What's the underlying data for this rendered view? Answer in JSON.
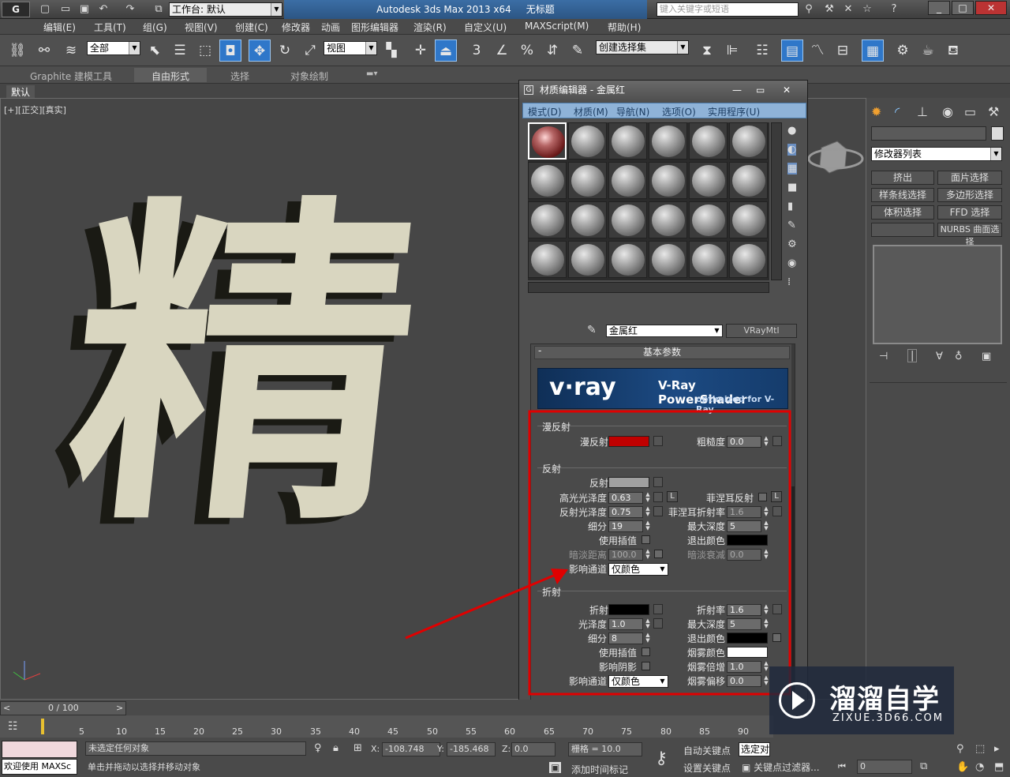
{
  "window": {
    "app_title": "Autodesk 3ds Max  2013 x64",
    "doc_title": "无标题",
    "workspace": "工作台: 默认",
    "search_placeholder": "键入关键字或短语"
  },
  "menu": [
    "编辑(E)",
    "工具(T)",
    "组(G)",
    "视图(V)",
    "创建(C)",
    "修改器",
    "动画",
    "图形编辑器",
    "渲染(R)",
    "自定义(U)",
    "MAXScript(M)",
    "帮助(H)"
  ],
  "toolbar": {
    "selection_filter": "全部",
    "ref_coord": "视图",
    "named_selection": "创建选择集",
    "snap_3": "3",
    "snap_percent": "%"
  },
  "ribbon": {
    "tabs": [
      "Graphite 建模工具",
      "自由形式",
      "选择",
      "对象绘制"
    ],
    "active": "自由形式",
    "sub_default": "默认"
  },
  "viewport": {
    "label": "[+][正交][真实]",
    "model_text": "精"
  },
  "command_panel": {
    "modifier_list": "修改器列表",
    "buttons": [
      "挤出",
      "面片选择",
      "样条线选择",
      "多边形选择",
      "体积选择",
      "FFD 选择",
      "",
      "NURBS 曲面选择"
    ]
  },
  "material_editor": {
    "title": "材质编辑器 - 金属红",
    "menu": [
      "模式(D)",
      "材质(M)",
      "导航(N)",
      "选项(O)",
      "实用程序(U)"
    ],
    "material_name": "金属红",
    "material_type": "VRayMtl",
    "rollout_title": "基本参数",
    "banner_logo": "v·ray",
    "banner_title": "V-Ray PowerShader",
    "banner_sub": "optimized for V-Ray",
    "diffuse": {
      "group": "漫反射",
      "label": "漫反射",
      "color": "#c00000",
      "roughness_label": "粗糙度",
      "roughness": "0.0"
    },
    "reflection": {
      "group": "反射",
      "label": "反射",
      "color": "#a0a0a0",
      "hilight_label": "高光光泽度",
      "hilight": "0.63",
      "l_btn": "L",
      "glossy_label": "反射光泽度",
      "glossy": "0.75",
      "subdiv_label": "细分",
      "subdiv": "19",
      "interp_label": "使用插值",
      "dim_dist_label": "暗淡距离",
      "dim_dist": "100.0",
      "affect_label": "影响通道",
      "affect_value": "仅颜色",
      "fresnel_label": "菲涅耳反射",
      "fresnel_ior_label": "菲涅耳折射率",
      "fresnel_ior": "1.6",
      "max_depth_label": "最大深度",
      "max_depth": "5",
      "exit_color_label": "退出颜色",
      "exit_color": "#000000",
      "dim_falloff_label": "暗淡衰减",
      "dim_falloff": "0.0"
    },
    "refraction": {
      "group": "折射",
      "label": "折射",
      "color": "#000000",
      "gloss_label": "光泽度",
      "gloss": "1.0",
      "subdiv_label": "细分",
      "subdiv": "8",
      "interp_label": "使用插值",
      "shadow_label": "影响阴影",
      "affect_label": "影响通道",
      "affect_value": "仅颜色",
      "ior_label": "折射率",
      "ior": "1.6",
      "max_depth_label": "最大深度",
      "max_depth": "5",
      "exit_color_label": "退出颜色",
      "exit_color": "#000000",
      "fog_color_label": "烟雾颜色",
      "fog_color": "#ffffff",
      "fog_mult_label": "烟雾倍增",
      "fog_mult": "1.0",
      "fog_bias_label": "烟雾偏移",
      "fog_bias": "0.0"
    }
  },
  "timeline": {
    "frame": "0 / 100",
    "ticks": [
      "5",
      "10",
      "15",
      "20",
      "25",
      "30",
      "35",
      "40",
      "45",
      "50",
      "55",
      "60",
      "65",
      "70",
      "75",
      "80",
      "85",
      "90"
    ]
  },
  "status": {
    "selection": "未选定任何对象",
    "hint": "单击并拖动以选择并移动对象",
    "welcome": "欢迎使用 MAXSc",
    "x_label": "X:",
    "x": "-108.748",
    "y_label": "Y:",
    "y": "-185.468",
    "z_label": "Z:",
    "z": "0.0",
    "grid": "栅格 = 10.0",
    "auto_key": "自动关键点",
    "set_key": "设置关键点",
    "key_filter": "关键点过滤器...",
    "add_time_tag": "添加时间标记",
    "selected": "选定对",
    "frame_value": "0"
  },
  "watermark": {
    "brand": "溜溜自学",
    "url": "ZIXUE.3D66.COM"
  },
  "accent": {
    "highlight_red": "#e00000",
    "menu_blue": "#8fb3d8"
  }
}
